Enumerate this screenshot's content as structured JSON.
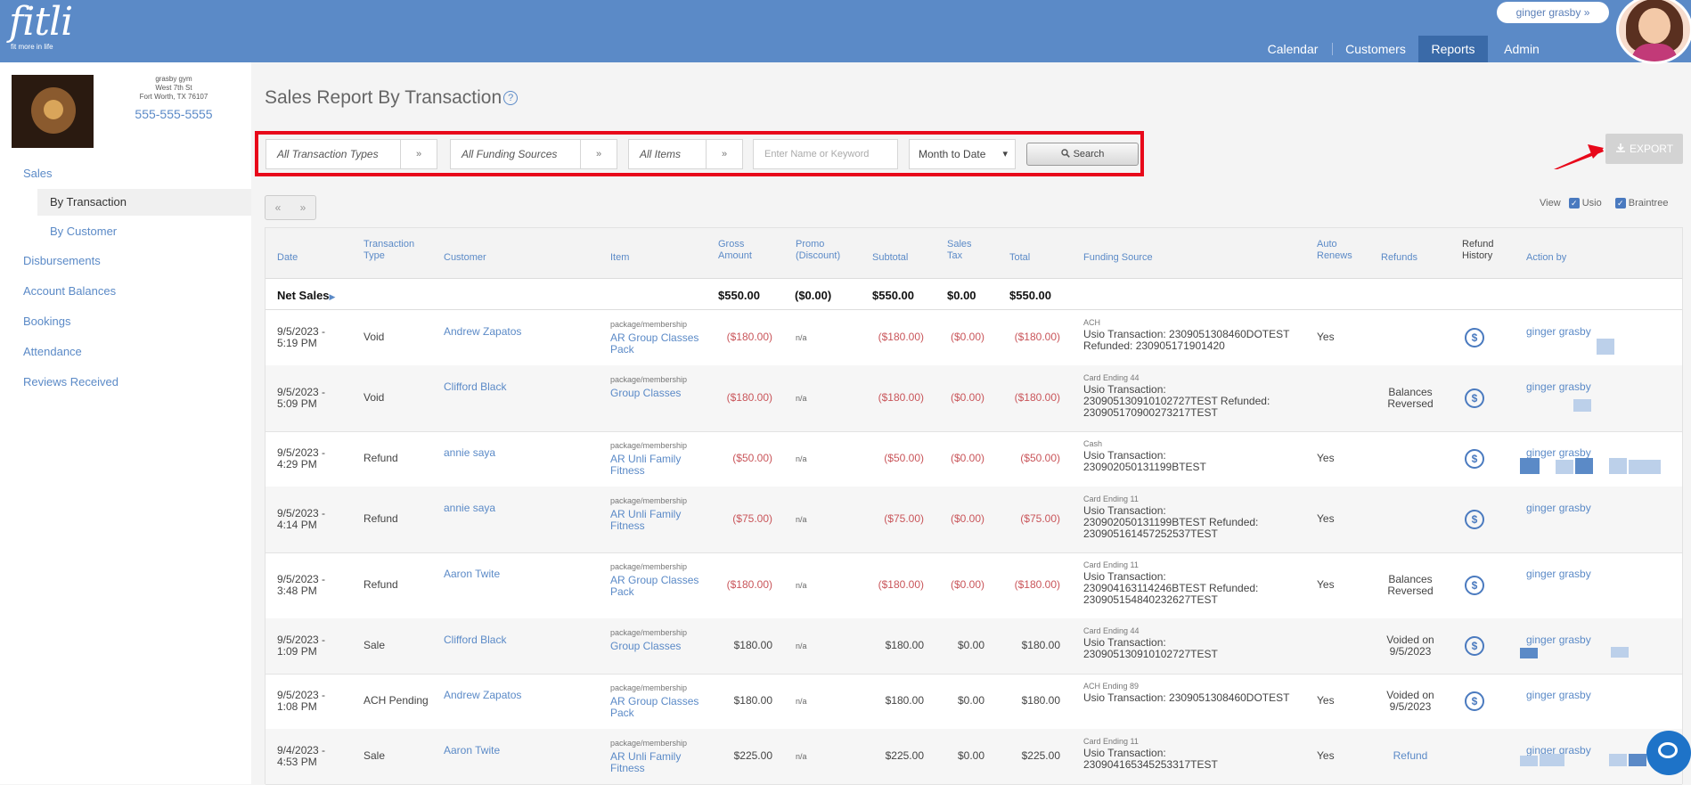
{
  "app": {
    "logo": "fitli",
    "tagline": "fit more in life",
    "user": "ginger grasby",
    "user_caret": "»"
  },
  "nav": [
    {
      "label": "Calendar",
      "active": false
    },
    {
      "label": "Customers",
      "active": false
    },
    {
      "label": "Reports",
      "active": true
    },
    {
      "label": "Admin",
      "active": false
    }
  ],
  "gym": {
    "name": "grasby gym",
    "street": "West 7th St",
    "city": "Fort Worth, TX 76107",
    "phone": "555-555-5555"
  },
  "sidebar": {
    "sales": "Sales",
    "by_transaction": "By Transaction",
    "by_customer": "By Customer",
    "disbursements": "Disbursements",
    "account_balances": "Account Balances",
    "bookings": "Bookings",
    "attendance": "Attendance",
    "reviews": "Reviews Received"
  },
  "page": {
    "title": "Sales Report By Transaction",
    "help": "?"
  },
  "filters": {
    "transaction_types": "All Transaction Types",
    "funding_sources": "All Funding Sources",
    "items": "All Items",
    "keyword_placeholder": "Enter Name or Keyword",
    "period": "Month to Date",
    "search": "Search",
    "chevron": "»",
    "caret": "▾"
  },
  "export": "EXPORT",
  "pager": {
    "prev": "«",
    "next": "»"
  },
  "view": {
    "label": "View",
    "usio": "Usio",
    "braintree": "Braintree"
  },
  "columns": {
    "date": "Date",
    "type1": "Transaction",
    "type2": "Type",
    "customer": "Customer",
    "item": "Item",
    "gross1": "Gross",
    "gross2": "Amount",
    "promo1": "Promo",
    "promo2": "(Discount)",
    "subtotal": "Subtotal",
    "tax1": "Sales",
    "tax2": "Tax",
    "total": "Total",
    "funding": "Funding Source",
    "auto1": "Auto",
    "auto2": "Renews",
    "refunds": "Refunds",
    "rh1": "Refund",
    "rh2": "History",
    "action": "Action by"
  },
  "net_sales": {
    "label": "Net Sales",
    "gross": "$550.00",
    "promo": "($0.00)",
    "subtotal": "$550.00",
    "tax": "$0.00",
    "total": "$550.00"
  },
  "rows": [
    {
      "date1": "9/5/2023 -",
      "date2": "5:19 PM",
      "type": "Void",
      "customer": "Andrew Zapatos",
      "item_cat": "package/membership",
      "item1": "AR Group Classes",
      "item2": "Pack",
      "gross": "($180.00)",
      "promo": "n/a",
      "subtotal": "($180.00)",
      "tax": "($0.00)",
      "total": "($180.00)",
      "fund1": "ACH",
      "fund2": "Usio Transaction: 2309051308460DOTEST",
      "fund3": "Refunded: 230905171901420",
      "auto": "Yes",
      "refunds1": "",
      "refunds2": "",
      "action": "ginger grasby"
    },
    {
      "date1": "9/5/2023 -",
      "date2": "5:09 PM",
      "type": "Void",
      "customer": "Clifford Black",
      "item_cat": "package/membership",
      "item1": "Group Classes",
      "item2": "",
      "gross": "($180.00)",
      "promo": "n/a",
      "subtotal": "($180.00)",
      "tax": "($0.00)",
      "total": "($180.00)",
      "fund1": "Card Ending 44",
      "fund2": "Usio Transaction:",
      "fund3": "230905130910102727TEST Refunded:",
      "fund4": "230905170900273217TEST",
      "auto": "",
      "refunds1": "Balances",
      "refunds2": "Reversed",
      "action": "ginger grasby"
    },
    {
      "date1": "9/5/2023 -",
      "date2": "4:29 PM",
      "type": "Refund",
      "customer": "annie saya",
      "item_cat": "package/membership",
      "item1": "AR Unli Family",
      "item2": "Fitness",
      "gross": "($50.00)",
      "promo": "n/a",
      "subtotal": "($50.00)",
      "tax": "($0.00)",
      "total": "($50.00)",
      "fund1": "Cash",
      "fund2": "Usio Transaction:",
      "fund3": "230902050131199BTEST",
      "auto": "Yes",
      "refunds1": "",
      "refunds2": "",
      "action": "ginger grasby"
    },
    {
      "date1": "9/5/2023 -",
      "date2": "4:14 PM",
      "type": "Refund",
      "customer": "annie saya",
      "item_cat": "package/membership",
      "item1": "AR Unli Family",
      "item2": "Fitness",
      "gross": "($75.00)",
      "promo": "n/a",
      "subtotal": "($75.00)",
      "tax": "($0.00)",
      "total": "($75.00)",
      "fund1": "Card Ending 11",
      "fund2": "Usio Transaction:",
      "fund3": "230902050131199BTEST Refunded:",
      "fund4": "230905161457252537TEST",
      "auto": "Yes",
      "refunds1": "",
      "refunds2": "",
      "action": "ginger grasby"
    },
    {
      "date1": "9/5/2023 -",
      "date2": "3:48 PM",
      "type": "Refund",
      "customer": "Aaron Twite",
      "item_cat": "package/membership",
      "item1": "AR Group Classes",
      "item2": "Pack",
      "gross": "($180.00)",
      "promo": "n/a",
      "subtotal": "($180.00)",
      "tax": "($0.00)",
      "total": "($180.00)",
      "fund1": "Card Ending 11",
      "fund2": "Usio Transaction:",
      "fund3": "230904163114246BTEST Refunded:",
      "fund4": "230905154840232627TEST",
      "auto": "Yes",
      "refunds1": "Balances",
      "refunds2": "Reversed",
      "action": "ginger grasby"
    },
    {
      "date1": "9/5/2023 -",
      "date2": "1:09 PM",
      "type": "Sale",
      "customer": "Clifford Black",
      "item_cat": "package/membership",
      "item1": "Group Classes",
      "item2": "",
      "gross": "$180.00",
      "promo": "n/a",
      "subtotal": "$180.00",
      "tax": "$0.00",
      "total": "$180.00",
      "fund1": "Card Ending 44",
      "fund2": "Usio Transaction:",
      "fund3": "230905130910102727TEST",
      "auto": "",
      "refunds1": "Voided on",
      "refunds2": "9/5/2023",
      "action": "ginger grasby"
    },
    {
      "date1": "9/5/2023 -",
      "date2": "1:08 PM",
      "type": "ACH Pending",
      "customer": "Andrew Zapatos",
      "item_cat": "package/membership",
      "item1": "AR Group Classes",
      "item2": "Pack",
      "gross": "$180.00",
      "promo": "n/a",
      "subtotal": "$180.00",
      "tax": "$0.00",
      "total": "$180.00",
      "fund1": "ACH Ending 89",
      "fund2": "Usio Transaction: 2309051308460DOTEST",
      "auto": "Yes",
      "refunds1": "Voided on",
      "refunds2": "9/5/2023",
      "action": "ginger grasby"
    },
    {
      "date1": "9/4/2023 -",
      "date2": "4:53 PM",
      "type": "Sale",
      "customer": "Aaron Twite",
      "item_cat": "package/membership",
      "item1": "AR Unli Family",
      "item2": "Fitness",
      "gross": "$225.00",
      "promo": "n/a",
      "subtotal": "$225.00",
      "tax": "$0.00",
      "total": "$225.00",
      "fund1": "Card Ending 11",
      "fund2": "Usio Transaction:",
      "fund3": "230904165345253317TEST",
      "auto": "Yes",
      "refunds1": "Refund",
      "refunds2": "",
      "action": "ginger grasby"
    }
  ]
}
